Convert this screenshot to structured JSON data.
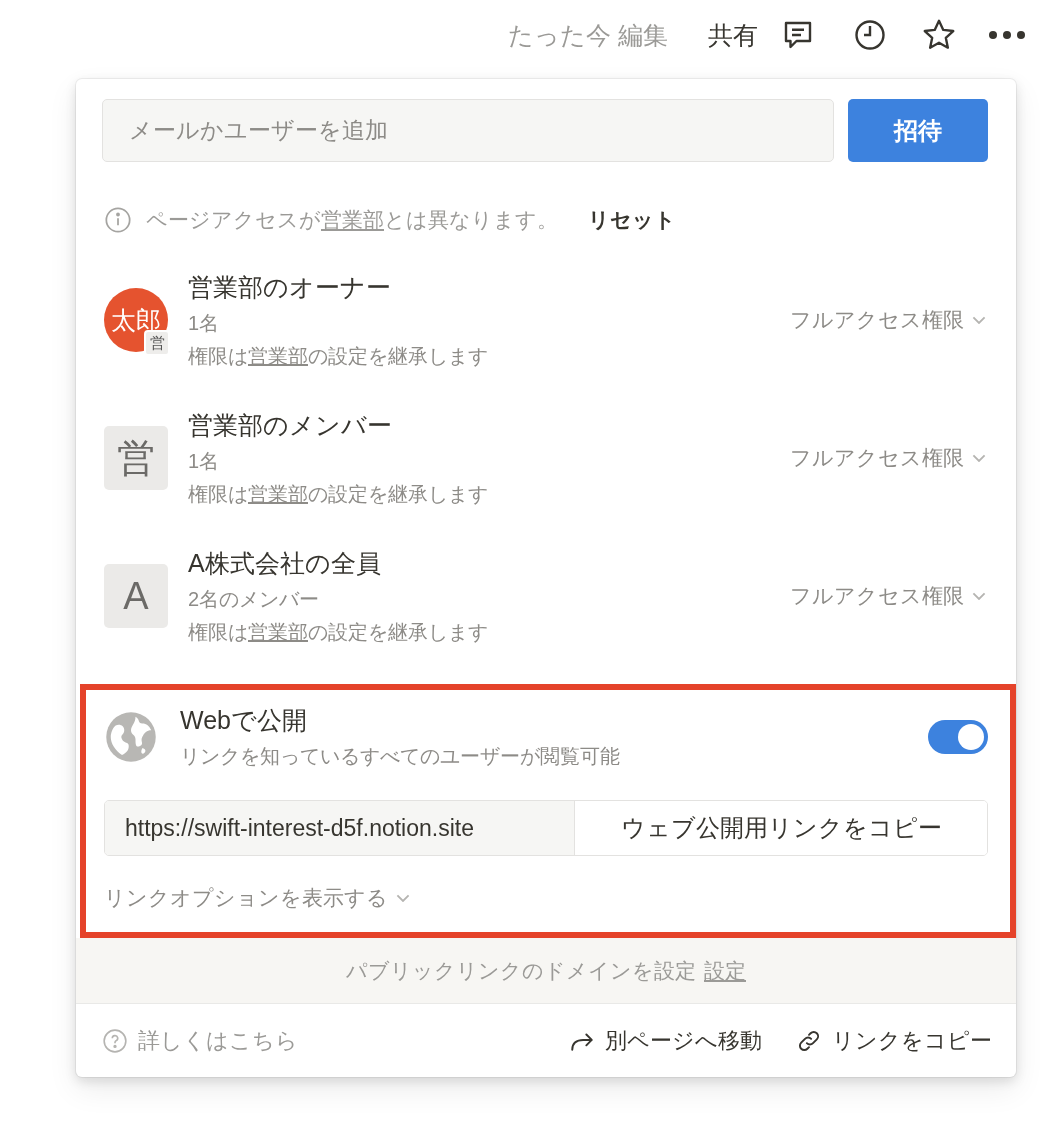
{
  "topbar": {
    "edited": "たった今 編集",
    "share": "共有"
  },
  "invite": {
    "placeholder": "メールかユーザーを追加",
    "button": "招待"
  },
  "notice": {
    "before": "ページアクセスが",
    "link": "営業部",
    "after": "とは異なります。",
    "reset": "リセット"
  },
  "members": [
    {
      "kind": "person",
      "avatar": "太郎",
      "badge": "営",
      "title": "営業部のオーナー",
      "count": "1名",
      "inherit_before": "権限は",
      "inherit_link": "営業部",
      "inherit_after": "の設定を継承します",
      "access": "フルアクセス権限"
    },
    {
      "kind": "letter",
      "avatar": "営",
      "title": "営業部のメンバー",
      "count": "1名",
      "inherit_before": "権限は",
      "inherit_link": "営業部",
      "inherit_after": "の設定を継承します",
      "access": "フルアクセス権限"
    },
    {
      "kind": "letter",
      "avatar": "A",
      "title": "A株式会社の全員",
      "count": "2名のメンバー",
      "inherit_before": "権限は",
      "inherit_link": "営業部",
      "inherit_after": "の設定を継承します",
      "access": "フルアクセス権限"
    }
  ],
  "publish": {
    "highlighted": true,
    "title": "Webで公開",
    "subtitle": "リンクを知っているすべてのユーザーが閲覧可能",
    "on": true,
    "url": "https://swift-interest-d5f.notion.site",
    "copy_button": "ウェブ公開用リンクをコピー",
    "options": "リンクオプションを表示する"
  },
  "domain": {
    "text": "パブリックリンクのドメインを設定",
    "link": "設定"
  },
  "footer": {
    "help": "詳しくはこちら",
    "move": "別ページへ移動",
    "copy_link": "リンクをコピー"
  }
}
